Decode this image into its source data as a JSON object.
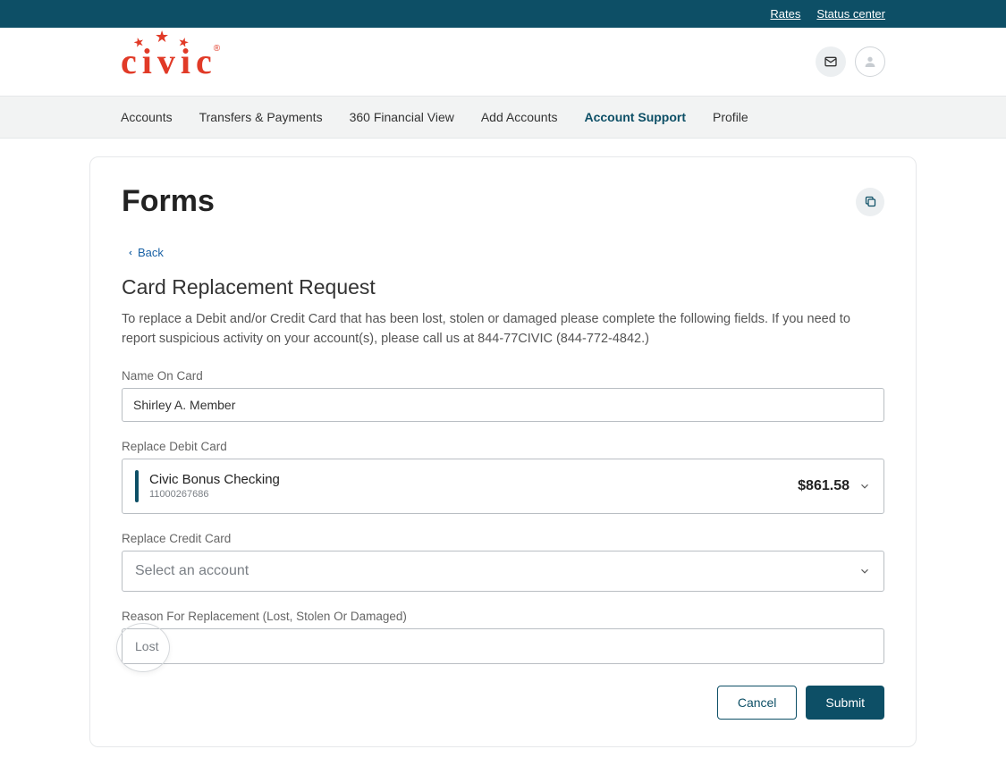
{
  "topbar": {
    "rates": "Rates",
    "status_center": "Status center"
  },
  "logo": {
    "text": "civic"
  },
  "nav": {
    "items": [
      {
        "label": "Accounts",
        "active": false
      },
      {
        "label": "Transfers & Payments",
        "active": false
      },
      {
        "label": "360 Financial View",
        "active": false
      },
      {
        "label": "Add Accounts",
        "active": false
      },
      {
        "label": "Account Support",
        "active": true
      },
      {
        "label": "Profile",
        "active": false
      }
    ]
  },
  "page": {
    "title": "Forms",
    "back_label": "Back",
    "subheading": "Card Replacement Request",
    "description": "To replace a Debit and/or Credit Card that has been lost, stolen or damaged please complete the following fields. If you need to report suspicious activity on your account(s), please call us at 844-77CIVIC (844-772-4842.)",
    "fields": {
      "name_label": "Name On Card",
      "name_value": "Shirley A. Member",
      "debit_label": "Replace Debit Card",
      "debit_account_name": "Civic Bonus Checking",
      "debit_account_number": "11000267686",
      "debit_balance": "$861.58",
      "credit_label": "Replace Credit Card",
      "credit_placeholder": "Select an account",
      "reason_label": "Reason For Replacement (Lost, Stolen Or Damaged)",
      "reason_value": "Lost"
    },
    "buttons": {
      "cancel": "Cancel",
      "submit": "Submit"
    }
  }
}
